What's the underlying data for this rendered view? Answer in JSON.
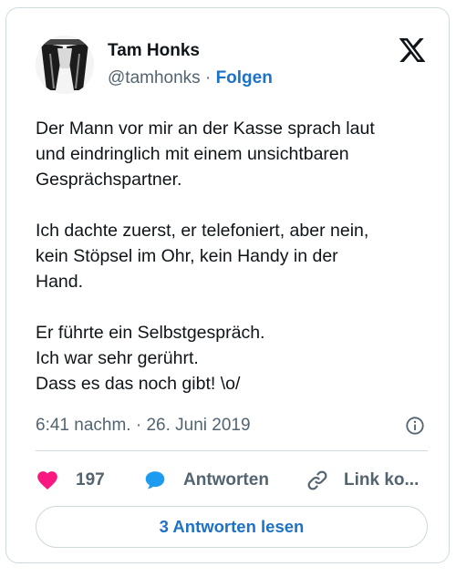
{
  "author": {
    "name": "Tam Honks",
    "handle": "@tamhonks",
    "separator": "·",
    "follow_label": "Folgen"
  },
  "tweet": {
    "paragraphs": [
      [
        "Der Mann vor mir an der Kasse sprach laut",
        "und eindringlich mit einem unsichtbaren",
        "Gesprächspartner."
      ],
      [
        "Ich dachte zuerst, er telefoniert, aber nein,",
        "kein Stöpsel im Ohr, kein Handy in der",
        "Hand."
      ],
      [
        "Er führte ein Selbstgespräch.",
        "Ich war sehr gerührt.",
        "Dass es das noch gibt! \\o/"
      ]
    ],
    "timestamp": "6:41 nachm. · 26. Juni 2019"
  },
  "actions": {
    "like_count": "197",
    "reply_label": "Antworten",
    "link_label": "Link ko..."
  },
  "read_replies_label": "3 Antworten lesen",
  "icons": {
    "like": "heart-icon",
    "reply": "speech-bubble-icon",
    "link": "chain-link-icon",
    "info": "info-icon",
    "brand": "x-logo-icon"
  },
  "colors": {
    "like": "#f91880",
    "reply": "#1d9bf0",
    "link_accent": "#1d72c8",
    "muted": "#536471",
    "border": "#cfd9de"
  }
}
